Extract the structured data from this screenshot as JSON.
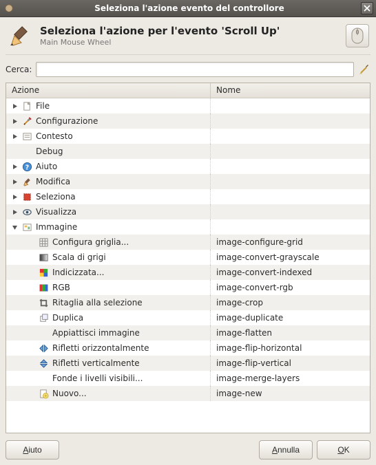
{
  "window": {
    "title": "Seleziona l'azione evento del controllore"
  },
  "header": {
    "title": "Seleziona l'azione per l'evento 'Scroll Up'",
    "subtitle": "Main Mouse Wheel"
  },
  "search": {
    "label": "Cerca:",
    "value": ""
  },
  "columns": {
    "action": "Azione",
    "name": "Nome"
  },
  "tree": {
    "nodes": [
      {
        "label": "File",
        "icon": "file",
        "expanded": false,
        "name": ""
      },
      {
        "label": "Configurazione",
        "icon": "config",
        "expanded": false,
        "name": ""
      },
      {
        "label": "Contesto",
        "icon": "context",
        "expanded": false,
        "name": ""
      },
      {
        "label": "Debug",
        "icon": "none",
        "expanded": null,
        "name": "",
        "noexpander": true
      },
      {
        "label": "Aiuto",
        "icon": "help",
        "expanded": false,
        "name": ""
      },
      {
        "label": "Modifica",
        "icon": "edit",
        "expanded": false,
        "name": ""
      },
      {
        "label": "Seleziona",
        "icon": "select",
        "expanded": false,
        "name": ""
      },
      {
        "label": "Visualizza",
        "icon": "view",
        "expanded": false,
        "name": ""
      },
      {
        "label": "Immagine",
        "icon": "image",
        "expanded": true,
        "name": "",
        "children": [
          {
            "label": "Configura griglia...",
            "icon": "grid",
            "name": "image-configure-grid"
          },
          {
            "label": "Scala di grigi",
            "icon": "gray",
            "name": "image-convert-grayscale"
          },
          {
            "label": "Indicizzata...",
            "icon": "indexed",
            "name": "image-convert-indexed"
          },
          {
            "label": "RGB",
            "icon": "rgb",
            "name": "image-convert-rgb"
          },
          {
            "label": "Ritaglia alla selezione",
            "icon": "crop",
            "name": "image-crop"
          },
          {
            "label": "Duplica",
            "icon": "duplicate",
            "name": "image-duplicate"
          },
          {
            "label": "Appiattisci immagine",
            "icon": "none",
            "name": "image-flatten"
          },
          {
            "label": "Rifletti orizzontalmente",
            "icon": "fliph",
            "name": "image-flip-horizontal"
          },
          {
            "label": "Rifletti verticalmente",
            "icon": "flipv",
            "name": "image-flip-vertical"
          },
          {
            "label": "Fonde i livelli visibili...",
            "icon": "none",
            "name": "image-merge-layers"
          },
          {
            "label": "Nuovo...",
            "icon": "new",
            "name": "image-new"
          }
        ]
      }
    ]
  },
  "buttons": {
    "help": "Aiuto",
    "cancel": "Annulla",
    "ok": "OK"
  }
}
